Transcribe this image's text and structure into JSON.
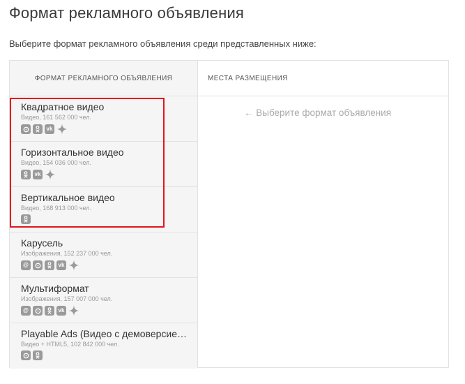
{
  "page": {
    "title": "Формат рекламного объявления",
    "subtitle": "Выберите формат рекламного объявления среди представленных ниже:"
  },
  "table": {
    "col_format_header": "ФОРМАТ РЕКЛАМНОГО ОБЪЯВЛЕНИЯ",
    "col_places_header": "МЕСТА РАЗМЕЩЕНИЯ",
    "placeholder_hint": "← Выберите формат объявления"
  },
  "formats": [
    {
      "title": "Квадратное видео",
      "meta": "Видео, 161 562 000 чел.",
      "icons": [
        "target-icon",
        "odnoklassniki-icon",
        "vk-icon",
        "sparkle-icon"
      ]
    },
    {
      "title": "Горизонтальное видео",
      "meta": "Видео, 154 036 000 чел.",
      "icons": [
        "odnoklassniki-icon",
        "vk-icon",
        "sparkle-icon"
      ]
    },
    {
      "title": "Вертикальное видео",
      "meta": "Видео, 168 913 000 чел.",
      "icons": [
        "odnoklassniki-icon"
      ]
    },
    {
      "title": "Карусель",
      "meta": "Изображения, 152 237 000 чел.",
      "icons": [
        "mail-icon",
        "target-icon",
        "odnoklassniki-icon",
        "vk-icon",
        "sparkle-icon"
      ]
    },
    {
      "title": "Мультиформат",
      "meta": "Изображения, 157 007 000 чел.",
      "icons": [
        "mail-icon",
        "target-icon",
        "odnoklassniki-icon",
        "vk-icon",
        "sparkle-icon"
      ]
    },
    {
      "title": "Playable Ads (Видео с демоверсией игры)",
      "meta": "Видео + HTML5, 102 842 000 чел.",
      "icons": [
        "target-icon",
        "odnoklassniki-icon"
      ]
    }
  ],
  "colors": {
    "highlight": "#e3131c",
    "icon_bg": "#9a9a9a"
  }
}
